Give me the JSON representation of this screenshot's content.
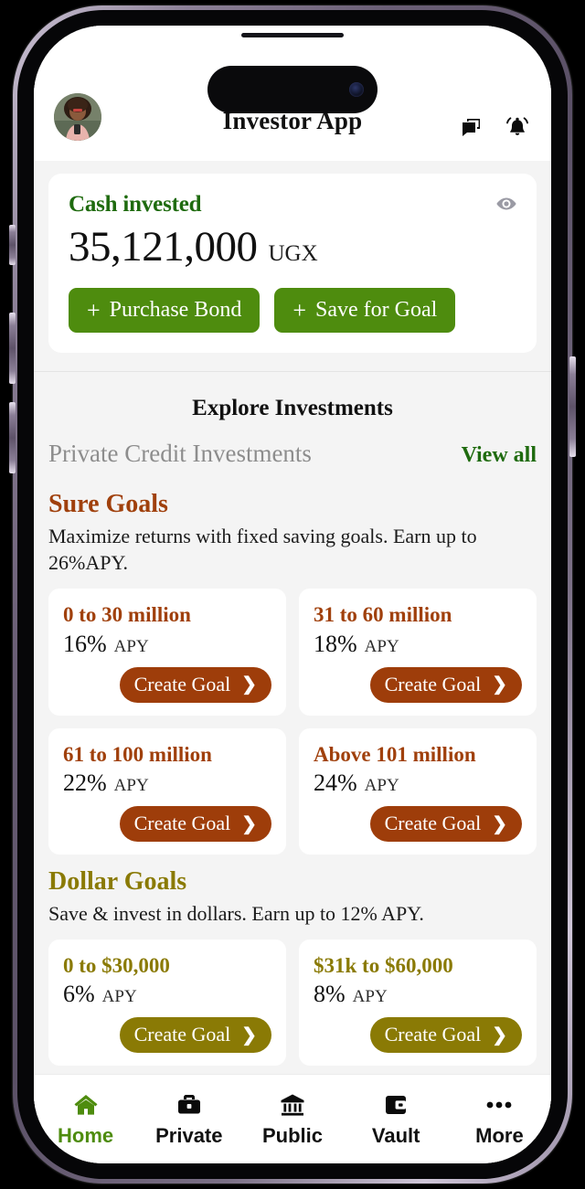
{
  "header": {
    "title": "Investor App",
    "avatar_name": "user-avatar",
    "chat_icon": "chat-bubbles-icon",
    "bell_icon": "notification-bell-icon"
  },
  "balance": {
    "label": "Cash invested",
    "amount": "35,121,000",
    "currency": "UGX",
    "eye_icon": "eye-visibility-icon",
    "buttons": [
      {
        "plus": "+",
        "label": "Purchase Bond"
      },
      {
        "plus": "+",
        "label": "Save for Goal"
      }
    ]
  },
  "explore": {
    "title": "Explore Investments",
    "section_label": "Private Credit Investments",
    "view_all": "View all"
  },
  "sure_goals": {
    "title": "Sure Goals",
    "description": "Maximize returns with fixed saving goals. Earn up to 26%APY.",
    "cta": "Create Goal",
    "chevron": "❯",
    "cards": [
      {
        "title": "0 to 30 million",
        "rate": "16%",
        "apy": "APY"
      },
      {
        "title": "31 to 60 million",
        "rate": "18%",
        "apy": "APY"
      },
      {
        "title": "61 to 100 million",
        "rate": "22%",
        "apy": "APY"
      },
      {
        "title": "Above 101 million",
        "rate": "24%",
        "apy": "APY"
      }
    ]
  },
  "dollar_goals": {
    "title": "Dollar Goals",
    "description": "Save & invest in dollars. Earn up to 12% APY.",
    "cta": "Create Goal",
    "chevron": "❯",
    "cards": [
      {
        "title": "0 to $30,000",
        "rate": "6%",
        "apy": "APY"
      },
      {
        "title": "$31k to $60,000",
        "rate": "8%",
        "apy": "APY"
      }
    ]
  },
  "bottom_nav": {
    "items": [
      {
        "label": "Home",
        "icon": "home-icon",
        "active": true
      },
      {
        "label": "Private",
        "icon": "briefcase-icon",
        "active": false
      },
      {
        "label": "Public",
        "icon": "bank-icon",
        "active": false
      },
      {
        "label": "Vault",
        "icon": "wallet-icon",
        "active": false
      },
      {
        "label": "More",
        "icon": "more-dots-icon",
        "active": false
      }
    ]
  },
  "colors": {
    "green": "#4e8c0e",
    "dark_green": "#1f6b0f",
    "rust": "#a0400c",
    "rust_pill": "#9e3d0a",
    "olive": "#8a7a05",
    "page_bg": "#f4f4f4"
  }
}
